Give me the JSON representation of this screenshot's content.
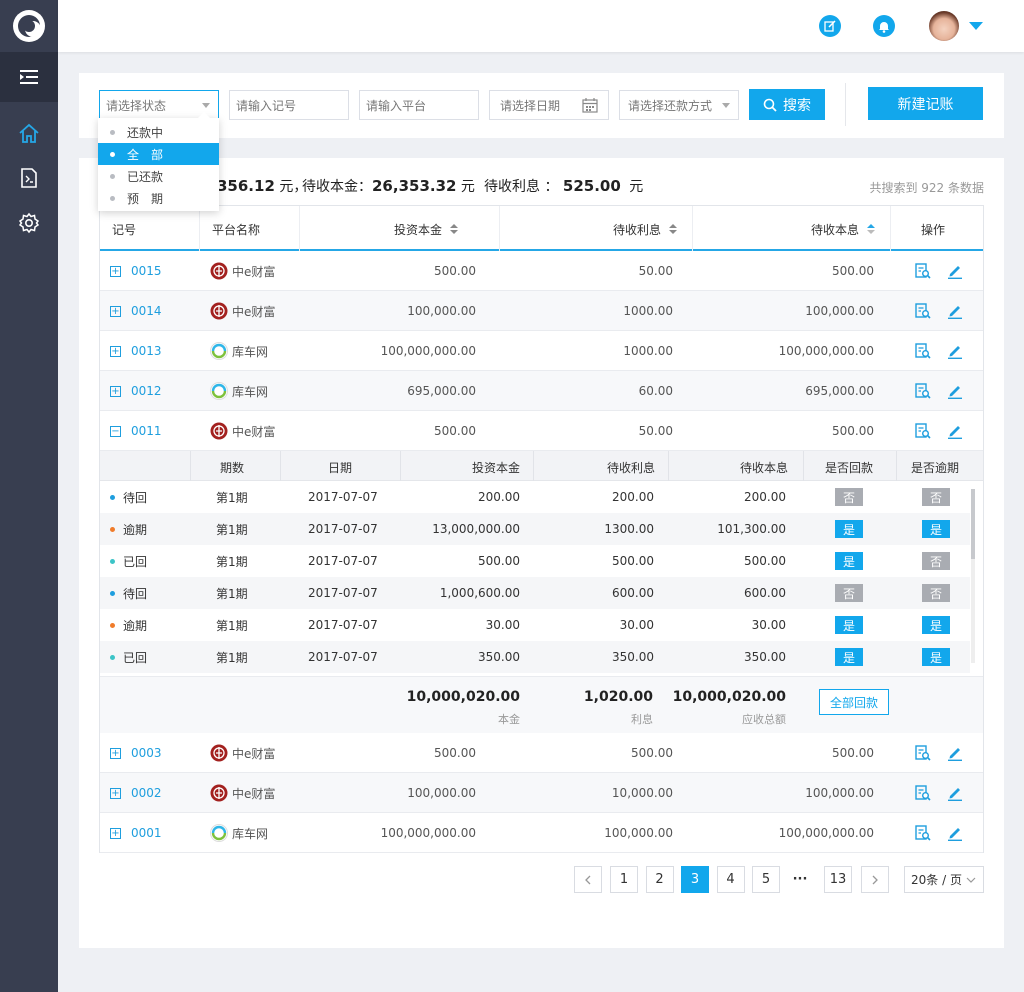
{
  "filters": {
    "status_placeholder": "请选择状态",
    "record_placeholder": "请输入记号",
    "platform_placeholder": "请输入平台",
    "date_placeholder": "请选择日期",
    "repay_placeholder": "请选择还款方式",
    "search_label": "搜索",
    "new_label": "新建记账"
  },
  "status_dropdown": [
    {
      "label": "还款中",
      "selected": false
    },
    {
      "label": "全　部",
      "selected": true
    },
    {
      "label": "已还款",
      "selected": false
    },
    {
      "label": "预　期",
      "selected": false
    }
  ],
  "summary": {
    "amount1": "356.12",
    "unit1": "元，",
    "label2": "待收本金：",
    "amount2": "26,353.32",
    "unit2": "元",
    "label3": "待收利息 ：",
    "amount3": "525.00",
    "unit3": "元",
    "count_text": "共搜索到 922 条数据"
  },
  "table": {
    "headers": {
      "id": "记号",
      "platform": "平台名称",
      "principal": "投资本金",
      "interest": "待收利息",
      "total": "待收本息",
      "ops": "操作"
    },
    "rows_top": [
      {
        "id": "0015",
        "platform": "中e财富",
        "logo": "zhonge",
        "principal": "500.00",
        "interest": "50.00",
        "total": "500.00"
      },
      {
        "id": "0014",
        "platform": "中e财富",
        "logo": "zhonge",
        "principal": "100,000.00",
        "interest": "1000.00",
        "total": "100,000.00"
      },
      {
        "id": "0013",
        "platform": "库车网",
        "logo": "kuche",
        "principal": "100,000,000.00",
        "interest": "1000.00",
        "total": "100,000,000.00"
      },
      {
        "id": "0012",
        "platform": "库车网",
        "logo": "kuche",
        "principal": "695,000.00",
        "interest": "60.00",
        "total": "695,000.00"
      },
      {
        "id": "0011",
        "platform": "中e财富",
        "logo": "zhonge",
        "principal": "500.00",
        "interest": "50.00",
        "total": "500.00"
      }
    ],
    "rows_bottom": [
      {
        "id": "0003",
        "platform": "中e财富",
        "logo": "zhonge",
        "principal": "500.00",
        "interest": "500.00",
        "total": "500.00"
      },
      {
        "id": "0002",
        "platform": "中e财富",
        "logo": "zhonge",
        "principal": "100,000.00",
        "interest": "10,000.00",
        "total": "100,000.00"
      },
      {
        "id": "0001",
        "platform": "库车网",
        "logo": "kuche",
        "principal": "100,000,000.00",
        "interest": "100,000.00",
        "total": "100,000,000.00"
      }
    ]
  },
  "subtable": {
    "headers": {
      "period": "期数",
      "date": "日期",
      "principal": "投资本金",
      "interest": "待收利息",
      "total": "待收本息",
      "repaid": "是否回款",
      "overdue": "是否逾期"
    },
    "rows": [
      {
        "status": "待回",
        "status_color": "#1e9ede",
        "period": "第1期",
        "date": "2017-07-07",
        "principal": "200.00",
        "interest": "200.00",
        "total": "200.00",
        "repaid": "否",
        "overdue": "否"
      },
      {
        "status": "逾期",
        "status_color": "#f07c2b",
        "period": "第1期",
        "date": "2017-07-07",
        "principal": "13,000,000.00",
        "interest": "1300.00",
        "total": "101,300.00",
        "repaid": "是",
        "overdue": "是"
      },
      {
        "status": "已回",
        "status_color": "#3cc4c7",
        "period": "第1期",
        "date": "2017-07-07",
        "principal": "500.00",
        "interest": "500.00",
        "total": "500.00",
        "repaid": "是",
        "overdue": "否"
      },
      {
        "status": "待回",
        "status_color": "#1e9ede",
        "period": "第1期",
        "date": "2017-07-07",
        "principal": "1,000,600.00",
        "interest": "600.00",
        "total": "600.00",
        "repaid": "否",
        "overdue": "否"
      },
      {
        "status": "逾期",
        "status_color": "#f07c2b",
        "period": "第1期",
        "date": "2017-07-07",
        "principal": "30.00",
        "interest": "30.00",
        "total": "30.00",
        "repaid": "是",
        "overdue": "是"
      },
      {
        "status": "已回",
        "status_color": "#3cc4c7",
        "period": "第1期",
        "date": "2017-07-07",
        "principal": "350.00",
        "interest": "350.00",
        "total": "350.00",
        "repaid": "是",
        "overdue": "是"
      }
    ],
    "totals": {
      "principal": "10,000,020.00",
      "principal_label": "本金",
      "interest": "1,020.00",
      "interest_label": "利息",
      "total": "10,000,020.00",
      "total_label": "应收总额",
      "repay_all_label": "全部回款"
    }
  },
  "pagination": {
    "pages": [
      "1",
      "2",
      "3",
      "4",
      "5"
    ],
    "current": "3",
    "ellipsis": "···",
    "last": "13",
    "page_size": "20条 / 页"
  },
  "colors": {
    "accent": "#12a7ec",
    "sidebar": "#383e50"
  }
}
